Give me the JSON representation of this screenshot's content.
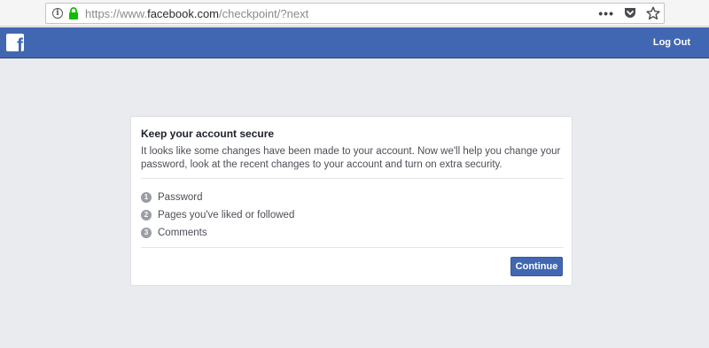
{
  "browser": {
    "url_prefix": "https://www.",
    "url_host": "facebook.com",
    "url_path": "/checkpoint/?next",
    "info_icon": "i",
    "menu_icon": "•••"
  },
  "header": {
    "logo_letter": "f",
    "logout_label": "Log Out",
    "brand_color": "#4267b2"
  },
  "card": {
    "title": "Keep your account secure",
    "description": "It looks like some changes have been made to your account. Now we'll help you change your password, look at the recent changes to your account and turn on extra security.",
    "steps": [
      {
        "number": "1",
        "label": "Password"
      },
      {
        "number": "2",
        "label": "Pages you've liked or followed"
      },
      {
        "number": "3",
        "label": "Comments"
      }
    ],
    "continue_label": "Continue"
  }
}
